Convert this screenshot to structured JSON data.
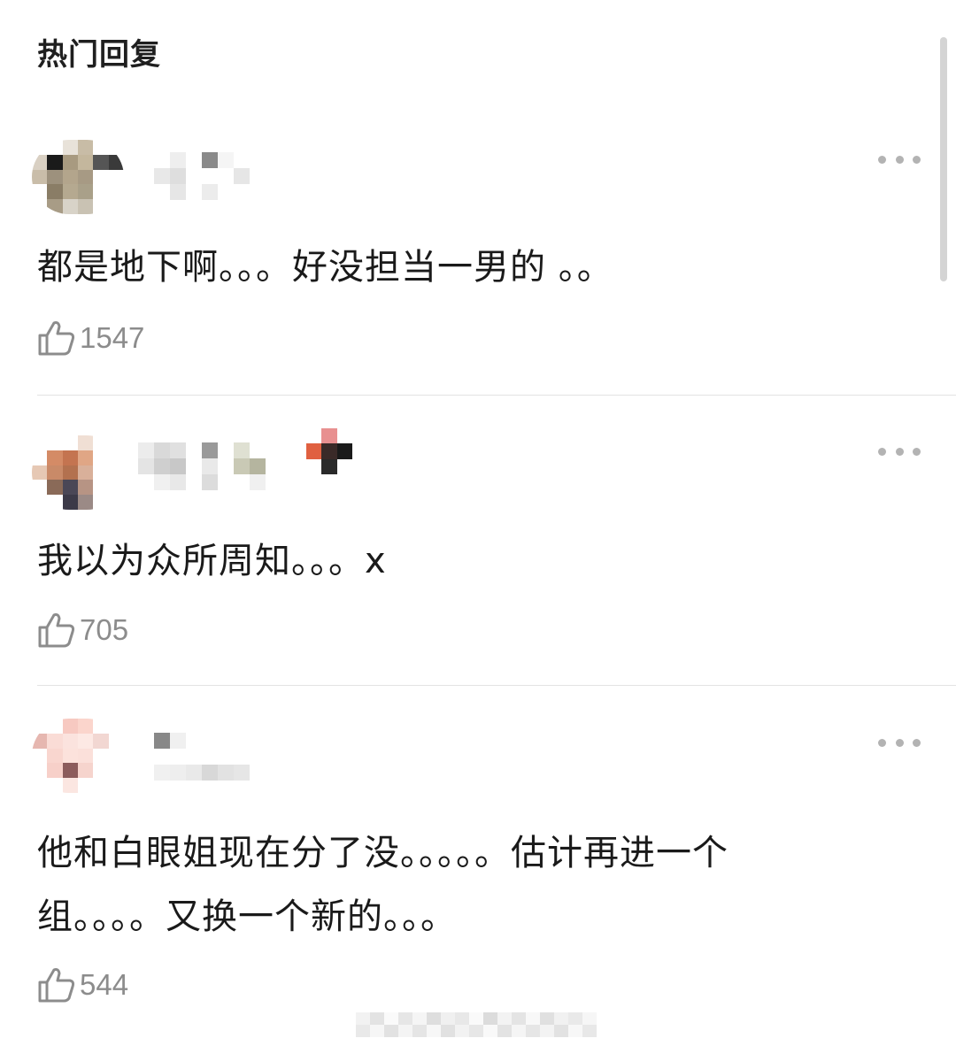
{
  "section": {
    "title": "热门回复"
  },
  "comments": [
    {
      "text": "都是地下啊。。。好没担当一男的 。。",
      "likes": "1547",
      "avatar_colors": [
        "#ffffff",
        "#ffffff",
        "#e8e2d9",
        "#c8bca6",
        "#ffffff",
        "#ffffff",
        "#d9d0c3",
        "#1a1a1a",
        "#a89a80",
        "#c4b79d",
        "#555555",
        "#3a3a3a",
        "#c9bda9",
        "#9d917d",
        "#b3a58c",
        "#a79a84",
        "#ffffff",
        "#ffffff",
        "#ffffff",
        "#8a7d66",
        "#b5a990",
        "#a9a089",
        "#ffffff",
        "#ffffff",
        "#ffffff",
        "#a89c86",
        "#d8d3c8",
        "#c9c2b3",
        "#ffffff",
        "#ffffff"
      ]
    },
    {
      "text": "我以为众所周知。。。x",
      "likes": "705",
      "avatar_colors": [
        "#ffffff",
        "#ffffff",
        "#ffffff",
        "#f0dfd4",
        "#ffffff",
        "#ffffff",
        "#ffffff",
        "#d48b66",
        "#c47450",
        "#e0a685",
        "#ffffff",
        "#ffffff",
        "#e6c8b4",
        "#c98a68",
        "#b3714f",
        "#d9b09a",
        "#ffffff",
        "#ffffff",
        "#ffffff",
        "#8a6a58",
        "#4a4756",
        "#b79484",
        "#ffffff",
        "#ffffff",
        "#ffffff",
        "#ffffff",
        "#3c3a48",
        "#9b8a86",
        "#ffffff",
        "#ffffff"
      ]
    },
    {
      "text": "他和白眼姐现在分了没。。。。。估计再进一个组。。。。又换一个新的。。。",
      "likes": "544",
      "avatar_colors": [
        "#ffffff",
        "#ffffff",
        "#f7c9c1",
        "#fbd5cc",
        "#ffffff",
        "#ffffff",
        "#e6b7b0",
        "#fadcd6",
        "#fbe3de",
        "#fde9e4",
        "#f2d7d2",
        "#ffffff",
        "#ffffff",
        "#f9d6cf",
        "#fce2dc",
        "#fbe0da",
        "#ffffff",
        "#ffffff",
        "#ffffff",
        "#f7d0c9",
        "#8c5c5c",
        "#f6d4cd",
        "#ffffff",
        "#ffffff",
        "#ffffff",
        "#ffffff",
        "#fbe6e1",
        "#ffffff",
        "#ffffff",
        "#ffffff"
      ]
    }
  ],
  "icons": {
    "like": "thumbs-up-icon",
    "more": "more-dots-icon"
  },
  "colors": {
    "text": "#1a1a1a",
    "muted": "#8c8c8c",
    "divider": "#e3e3e3"
  }
}
